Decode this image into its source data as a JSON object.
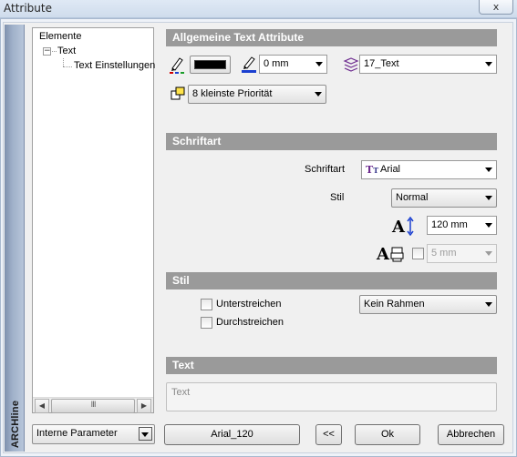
{
  "window": {
    "title": "Attribute",
    "close_label": "x",
    "brand": "ARCHline"
  },
  "tree": {
    "root": "Elemente",
    "child": "Text",
    "grandchild": "Text Einstellungen",
    "expander": "−",
    "scroll_thumb": "III"
  },
  "sections": {
    "general": "Allgemeine Text Attribute",
    "font": "Schriftart",
    "style": "Stil",
    "text": "Text"
  },
  "general": {
    "pen_color": "#000000",
    "pen_width": "0 mm",
    "layer": "17_Text",
    "priority": "8 kleinste Priorität"
  },
  "font": {
    "font_label": "Schriftart",
    "font_value": "Arial",
    "style_label": "Stil",
    "style_value": "Normal",
    "height_value": "120 mm",
    "spacing_value": "5 mm"
  },
  "style": {
    "underline_label": "Unterstreichen",
    "strikethrough_label": "Durchstreichen",
    "frame_value": "Kein Rahmen"
  },
  "text": {
    "placeholder": "Text"
  },
  "footer": {
    "params_value": "Interne Parameter",
    "style_name_button": "Arial_120",
    "back_button": "<<",
    "ok_button": "Ok",
    "cancel_button": "Abbrechen"
  }
}
